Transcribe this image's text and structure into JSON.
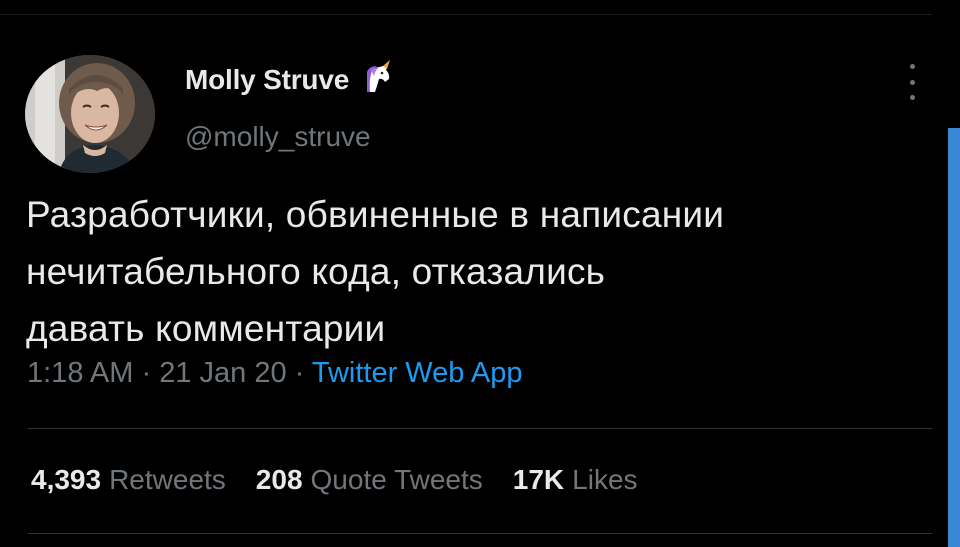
{
  "tweet": {
    "author": {
      "display_name": "Molly Struve",
      "badge_icon": "unicorn-icon",
      "handle": "@molly_struve"
    },
    "text": "Разработчики, обвиненные в написании\nнечитабельного кода, отказались\nдавать комментарии",
    "time": "1:18 AM",
    "date": "21 Jan 20",
    "separator": "·",
    "source": "Twitter Web App",
    "stats": {
      "retweets": {
        "value": "4,393",
        "label": "Retweets"
      },
      "quote_tweets": {
        "value": "208",
        "label": "Quote Tweets"
      },
      "likes": {
        "value": "17K",
        "label": "Likes"
      }
    }
  },
  "colors": {
    "background": "#000000",
    "text_primary": "#e7e9ea",
    "text_secondary": "#71767b",
    "link": "#1d9bf0",
    "scrollbar": "#3a87d6",
    "divider": "#2f3336"
  },
  "icons": {
    "more": "more-vertical-icon"
  }
}
